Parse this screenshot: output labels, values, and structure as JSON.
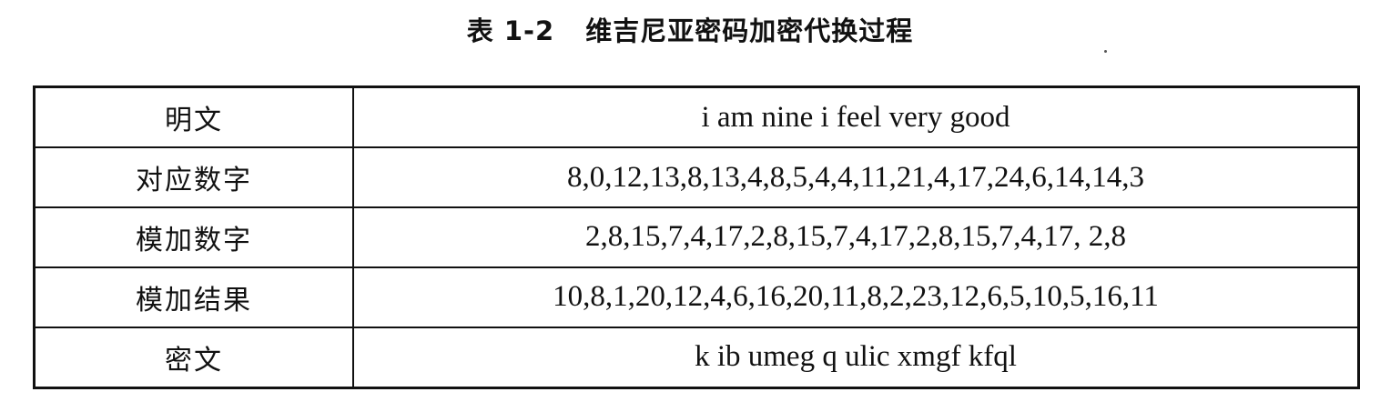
{
  "caption": {
    "number": "表 1-2",
    "title": "维吉尼亚密码加密代换过程"
  },
  "table": {
    "rows": [
      {
        "label": "明文",
        "value": "i am nine i feel very good"
      },
      {
        "label": "对应数字",
        "value": "8,0,12,13,8,13,4,8,5,4,4,11,21,4,17,24,6,14,14,3"
      },
      {
        "label": "模加数字",
        "value": "2,8,15,7,4,17,2,8,15,7,4,17,2,8,15,7,4,17, 2,8"
      },
      {
        "label": "模加结果",
        "value": "10,8,1,20,12,4,6,16,20,11,8,2,23,12,6,5,10,5,16,11"
      },
      {
        "label": "密文",
        "value": "k ib umeg q ulic xmgf kfql"
      }
    ]
  }
}
